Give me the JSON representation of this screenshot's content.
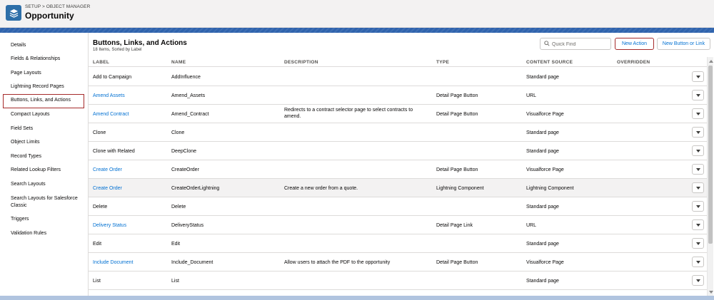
{
  "header": {
    "breadcrumb_setup": "SETUP",
    "breadcrumb_sep": ">",
    "breadcrumb_object_manager": "OBJECT MANAGER",
    "title": "Opportunity",
    "icon": "layers-icon"
  },
  "sidebar": {
    "items": [
      {
        "label": "Details"
      },
      {
        "label": "Fields & Relationships"
      },
      {
        "label": "Page Layouts"
      },
      {
        "label": "Lightning Record Pages"
      },
      {
        "label": "Buttons, Links, and Actions",
        "selected": true
      },
      {
        "label": "Compact Layouts"
      },
      {
        "label": "Field Sets"
      },
      {
        "label": "Object Limits"
      },
      {
        "label": "Record Types"
      },
      {
        "label": "Related Lookup Filters"
      },
      {
        "label": "Search Layouts"
      },
      {
        "label": "Search Layouts for Salesforce Classic"
      },
      {
        "label": "Triggers"
      },
      {
        "label": "Validation Rules"
      }
    ]
  },
  "main": {
    "title": "Buttons, Links, and Actions",
    "subtitle": "18 Items, Sorted by Label",
    "quick_find_placeholder": "Quick Find",
    "new_action_label": "New Action",
    "new_button_label": "New Button or Link"
  },
  "table": {
    "headers": [
      "LABEL",
      "NAME",
      "DESCRIPTION",
      "TYPE",
      "CONTENT SOURCE",
      "OVERRIDDEN"
    ],
    "rows": [
      {
        "label": "Add to Campaign",
        "link": false,
        "name": "AddInfluence",
        "description": "",
        "type": "",
        "content_source": "Standard page",
        "overridden": ""
      },
      {
        "label": "Amend Assets",
        "link": true,
        "name": "Amend_Assets",
        "description": "",
        "type": "Detail Page Button",
        "content_source": "URL",
        "overridden": ""
      },
      {
        "label": "Amend Contract",
        "link": true,
        "name": "Amend_Contract",
        "description": "Redirects to a contract selector page to select contracts to amend.",
        "type": "Detail Page Button",
        "content_source": "Visualforce Page",
        "overridden": ""
      },
      {
        "label": "Clone",
        "link": false,
        "name": "Clone",
        "description": "",
        "type": "",
        "content_source": "Standard page",
        "overridden": ""
      },
      {
        "label": "Clone with Related",
        "link": false,
        "name": "DeepClone",
        "description": "",
        "type": "",
        "content_source": "Standard page",
        "overridden": ""
      },
      {
        "label": "Create Order",
        "link": true,
        "name": "CreateOrder",
        "description": "",
        "type": "Detail Page Button",
        "content_source": "Visualforce Page",
        "overridden": ""
      },
      {
        "label": "Create Order",
        "link": true,
        "name": "CreateOrderLightning",
        "description": "Create a new order from a quote.",
        "type": "Lightning Component",
        "content_source": "Lightning Component",
        "overridden": "",
        "hover": true
      },
      {
        "label": "Delete",
        "link": false,
        "name": "Delete",
        "description": "",
        "type": "",
        "content_source": "Standard page",
        "overridden": ""
      },
      {
        "label": "Delivery Status",
        "link": true,
        "name": "DeliveryStatus",
        "description": "",
        "type": "Detail Page Link",
        "content_source": "URL",
        "overridden": ""
      },
      {
        "label": "Edit",
        "link": false,
        "name": "Edit",
        "description": "",
        "type": "",
        "content_source": "Standard page",
        "overridden": ""
      },
      {
        "label": "Include Document",
        "link": true,
        "name": "Include_Document",
        "description": "Allow users to attach the PDF to the opportunity",
        "type": "Detail Page Button",
        "content_source": "Visualforce Page",
        "overridden": ""
      },
      {
        "label": "List",
        "link": false,
        "name": "List",
        "description": "",
        "type": "",
        "content_source": "Standard page",
        "overridden": ""
      }
    ]
  },
  "colors": {
    "brand_blue": "#2f63ad",
    "link": "#0070d2",
    "highlight_border": "#a52a2a"
  }
}
